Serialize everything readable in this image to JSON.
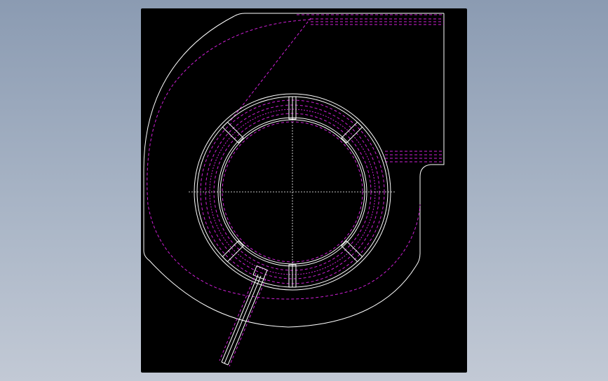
{
  "colors": {
    "background_top": "#8b9bb2",
    "background_bottom": "#c2c9d5",
    "viewport": "#000000",
    "visible_edges": "#ffffff",
    "hidden_edges": "#d020d8"
  },
  "drawing": {
    "view": "top view",
    "parts": [
      "volute-housing",
      "outlet-duct",
      "impeller-ring",
      "spoke-bracket",
      "support-rod",
      "centerlines"
    ]
  }
}
